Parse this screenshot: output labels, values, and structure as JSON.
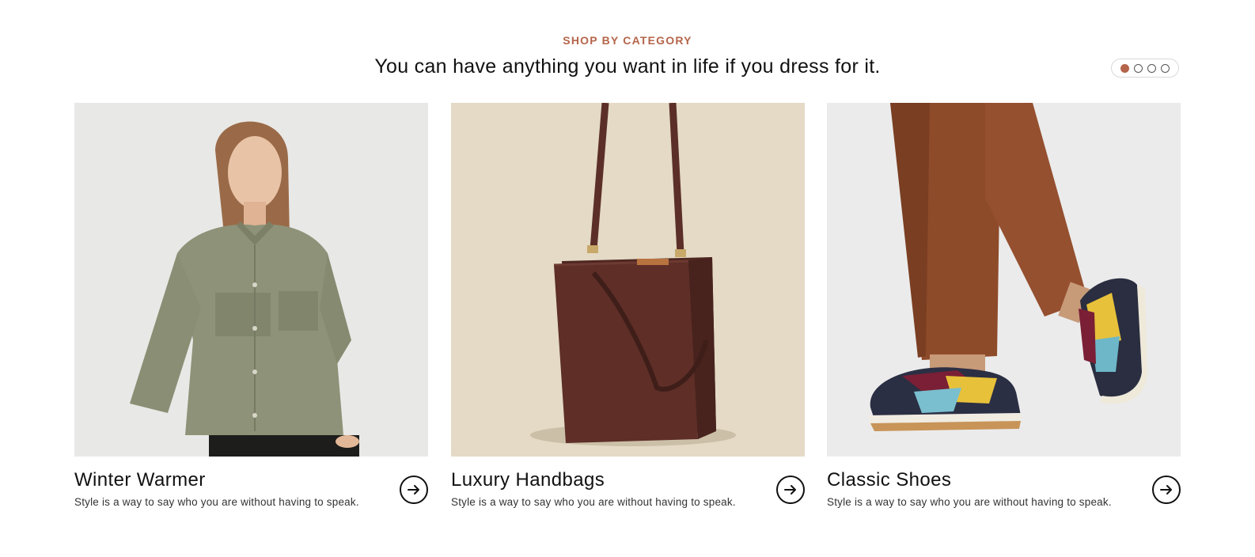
{
  "section": {
    "eyebrow": "SHOP BY CATEGORY",
    "headline": "You can have anything you want in life if you dress for it."
  },
  "pagination": {
    "count": 4,
    "active_index": 0
  },
  "colors": {
    "accent": "#b5654a",
    "text": "#111111",
    "muted": "#333333"
  },
  "cards": [
    {
      "title": "Winter Warmer",
      "description": "Style is a way to say who you are without having to speak.",
      "image": "olive-shirt-model-photo",
      "icon": "arrow-right-icon"
    },
    {
      "title": "Luxury Handbags",
      "description": "Style is a way to say who you are without having to speak.",
      "image": "brown-leather-handbag-photo",
      "icon": "arrow-right-icon"
    },
    {
      "title": "Classic Shoes",
      "description": "Style is a way to say who you are without having to speak.",
      "image": "sneakers-and-trousers-photo",
      "icon": "arrow-right-icon"
    }
  ]
}
